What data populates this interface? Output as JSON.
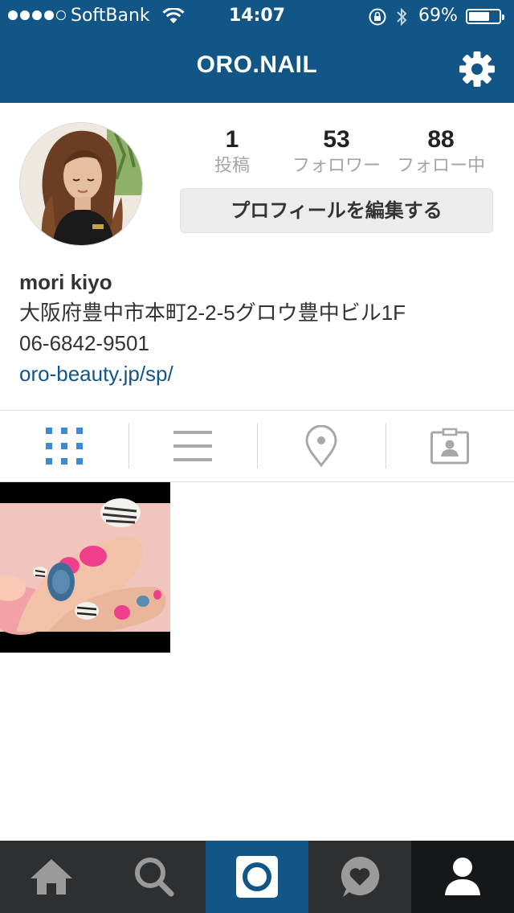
{
  "status_bar": {
    "carrier": "SoftBank",
    "time": "14:07",
    "battery_percent": "69%",
    "battery_level": 0.69,
    "signal_bars": 4
  },
  "nav": {
    "title": "ORO.NAIL",
    "settings_icon": "gear-icon"
  },
  "profile": {
    "stats": [
      {
        "count": "1",
        "label": "投稿"
      },
      {
        "count": "53",
        "label": "フォロワー"
      },
      {
        "count": "88",
        "label": "フォロー中"
      }
    ],
    "edit_button": "プロフィールを編集する",
    "username": "mori kiyo",
    "bio_address": "大阪府豊中市本町2-2-5グロウ豊中ビル1F",
    "bio_phone": "06-6842-9501",
    "website": "oro-beauty.jp/sp/"
  },
  "view_tabs": [
    {
      "icon": "grid-icon",
      "active": true
    },
    {
      "icon": "list-icon",
      "active": false
    },
    {
      "icon": "location-pin-icon",
      "active": false
    },
    {
      "icon": "tagged-photos-icon",
      "active": false
    }
  ],
  "tab_bar": [
    {
      "icon": "home-icon"
    },
    {
      "icon": "search-icon"
    },
    {
      "icon": "camera-icon"
    },
    {
      "icon": "activity-heart-icon"
    },
    {
      "icon": "profile-icon",
      "active": true
    }
  ],
  "colors": {
    "brand": "#125688",
    "tab_bar": "#2d2f31",
    "active_tab": "#161718",
    "active_view_icon": "#3f88d4",
    "inactive_view_icon": "#a8a8a8"
  }
}
